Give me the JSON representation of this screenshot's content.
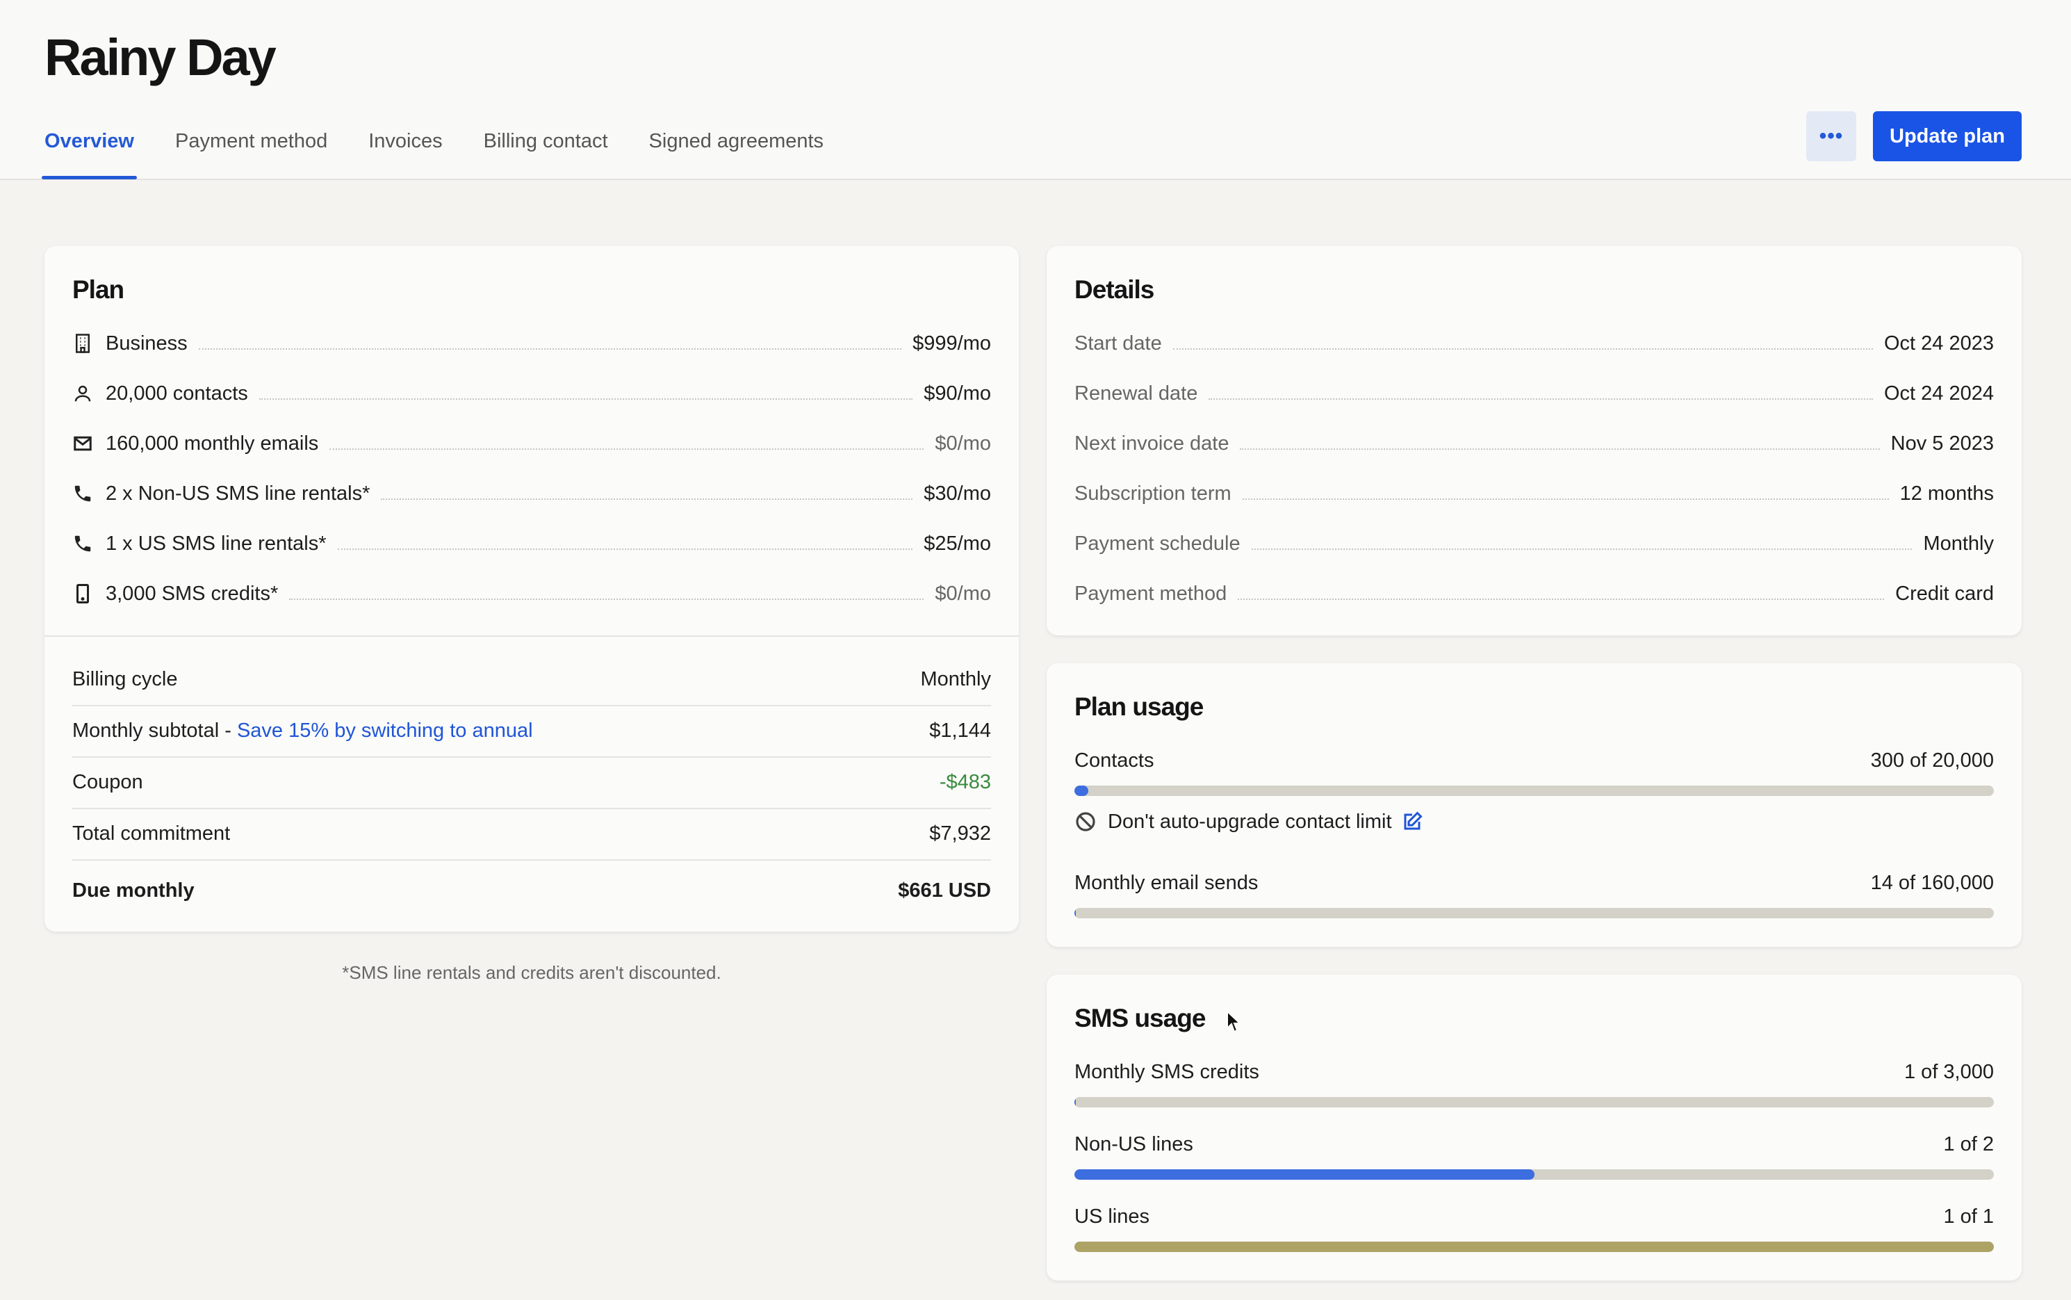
{
  "header": {
    "title": "Rainy Day",
    "tabs": [
      {
        "label": "Overview",
        "active": true
      },
      {
        "label": "Payment method",
        "active": false
      },
      {
        "label": "Invoices",
        "active": false
      },
      {
        "label": "Billing contact",
        "active": false
      },
      {
        "label": "Signed agreements",
        "active": false
      }
    ],
    "more_label": "•••",
    "more_icon": "more-horizontal-icon",
    "update_label": "Update plan",
    "accent_color": "#1a54e6"
  },
  "plan": {
    "title": "Plan",
    "items": [
      {
        "icon": "building-icon",
        "label": "Business",
        "price": "$999/mo",
        "muted": false
      },
      {
        "icon": "person-icon",
        "label": "20,000 contacts",
        "price": "$90/mo",
        "muted": false
      },
      {
        "icon": "envelope-icon",
        "label": "160,000 monthly emails",
        "price": "$0/mo",
        "muted": true
      },
      {
        "icon": "phone-icon",
        "label": "2 x Non-US SMS line rentals*",
        "price": "$30/mo",
        "muted": false
      },
      {
        "icon": "phone-icon",
        "label": "1 x US SMS line rentals*",
        "price": "$25/mo",
        "muted": false
      },
      {
        "icon": "mobile-device-icon",
        "label": "3,000 SMS credits*",
        "price": "$0/mo",
        "muted": true
      }
    ],
    "billing_cycle": {
      "label": "Billing cycle",
      "value": "Monthly"
    },
    "subtotal": {
      "label": "Monthly subtotal - ",
      "link": "Save 15% by switching to annual",
      "value": "$1,144"
    },
    "coupon": {
      "label": "Coupon",
      "value": "-$483"
    },
    "total_commitment": {
      "label": "Total commitment",
      "value": "$7,932"
    },
    "due": {
      "label": "Due monthly",
      "value": "$661 USD"
    },
    "footnote": "*SMS line rentals and credits aren't discounted."
  },
  "details": {
    "title": "Details",
    "rows": [
      {
        "label": "Start date",
        "value": "Oct 24 2023"
      },
      {
        "label": "Renewal date",
        "value": "Oct 24 2024"
      },
      {
        "label": "Next invoice date",
        "value": "Nov 5 2023"
      },
      {
        "label": "Subscription term",
        "value": "12 months"
      },
      {
        "label": "Payment schedule",
        "value": "Monthly"
      },
      {
        "label": "Payment method",
        "value": "Credit card"
      }
    ]
  },
  "plan_usage": {
    "title": "Plan usage",
    "contacts": {
      "label": "Contacts",
      "value": "300 of 20,000",
      "fraction": 0.015,
      "color": "#3d6ee0"
    },
    "auto_upgrade_note": "Don't auto-upgrade contact limit",
    "auto_upgrade_icon": "block-icon",
    "edit_icon": "edit-icon",
    "emails": {
      "label": "Monthly email sends",
      "value": "14 of 160,000",
      "fraction": 0.0001,
      "color": "#3d6ee0"
    }
  },
  "sms_usage": {
    "title": "SMS usage",
    "items": [
      {
        "label": "Monthly SMS credits",
        "value": "1 of 3,000",
        "fraction": 0.0003,
        "color": "#3d6ee0"
      },
      {
        "label": "Non-US lines",
        "value": "1 of 2",
        "fraction": 0.5,
        "color": "#3d6ee0"
      },
      {
        "label": "US lines",
        "value": "1 of 1",
        "fraction": 1.0,
        "color": "#ada365"
      }
    ]
  }
}
